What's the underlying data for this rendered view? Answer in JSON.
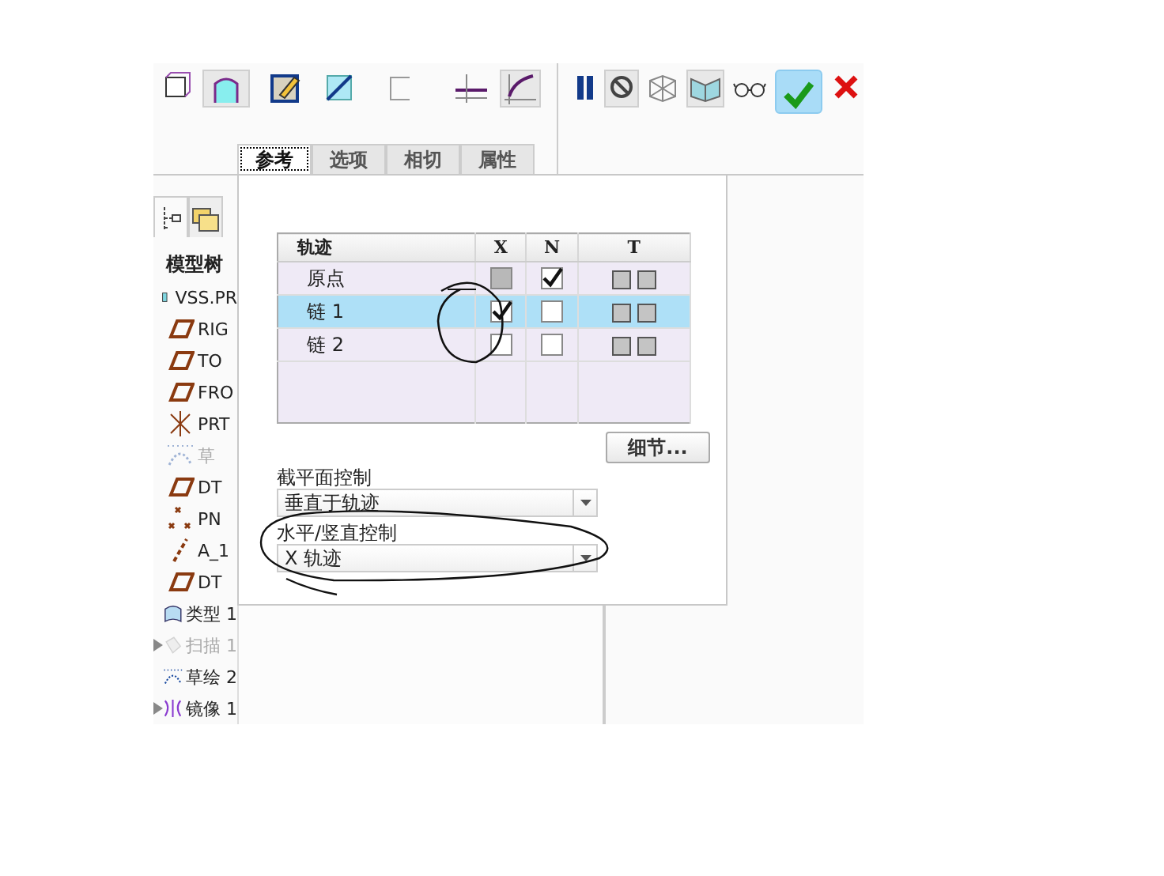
{
  "tabs": [
    {
      "label": "参考",
      "selected": true
    },
    {
      "label": "选项",
      "selected": false
    },
    {
      "label": "相切",
      "selected": false
    },
    {
      "label": "属性",
      "selected": false
    }
  ],
  "model_tree": {
    "title": "模型树",
    "items": [
      {
        "label": "VSS.PR",
        "kind": "part",
        "disabled": false,
        "expandable": false
      },
      {
        "label": "RIG",
        "kind": "plane",
        "disabled": false,
        "expandable": false
      },
      {
        "label": "TO",
        "kind": "plane",
        "disabled": false,
        "expandable": false
      },
      {
        "label": "FRO",
        "kind": "plane",
        "disabled": false,
        "expandable": false
      },
      {
        "label": "PRT",
        "kind": "csys",
        "disabled": false,
        "expandable": false
      },
      {
        "label": "草",
        "kind": "sketch",
        "disabled": true,
        "expandable": false
      },
      {
        "label": "DT",
        "kind": "plane",
        "disabled": false,
        "expandable": false
      },
      {
        "label": "PN",
        "kind": "point",
        "disabled": false,
        "expandable": false
      },
      {
        "label": "A_1",
        "kind": "axis",
        "disabled": false,
        "expandable": false
      },
      {
        "label": "DT",
        "kind": "plane",
        "disabled": false,
        "expandable": false
      },
      {
        "label": "类型 1",
        "kind": "surface",
        "disabled": false,
        "expandable": false
      },
      {
        "label": "扫描 1",
        "kind": "sweep",
        "disabled": true,
        "expandable": true
      },
      {
        "label": "草绘 2",
        "kind": "sketch",
        "disabled": false,
        "expandable": false
      },
      {
        "label": "镜像 1",
        "kind": "mirror",
        "disabled": false,
        "expandable": true
      }
    ]
  },
  "references_panel": {
    "table": {
      "columns": [
        "轨迹",
        "X",
        "N",
        "T"
      ],
      "rows": [
        {
          "name": "原点",
          "selected": false,
          "x": {
            "checked": false,
            "disabled": true
          },
          "n": {
            "checked": true,
            "disabled": false
          }
        },
        {
          "name": "链 1",
          "selected": true,
          "x": {
            "checked": true,
            "disabled": false
          },
          "n": {
            "checked": false,
            "disabled": false
          }
        },
        {
          "name": "链 2",
          "selected": false,
          "x": {
            "checked": false,
            "disabled": false
          },
          "n": {
            "checked": false,
            "disabled": false
          }
        }
      ]
    },
    "details_button": "细节...",
    "section_plane_control": {
      "label": "截平面控制",
      "value": "垂直于轨迹"
    },
    "horizontal_vertical_control": {
      "label": "水平/竖直控制",
      "value": "X 轨迹"
    }
  }
}
